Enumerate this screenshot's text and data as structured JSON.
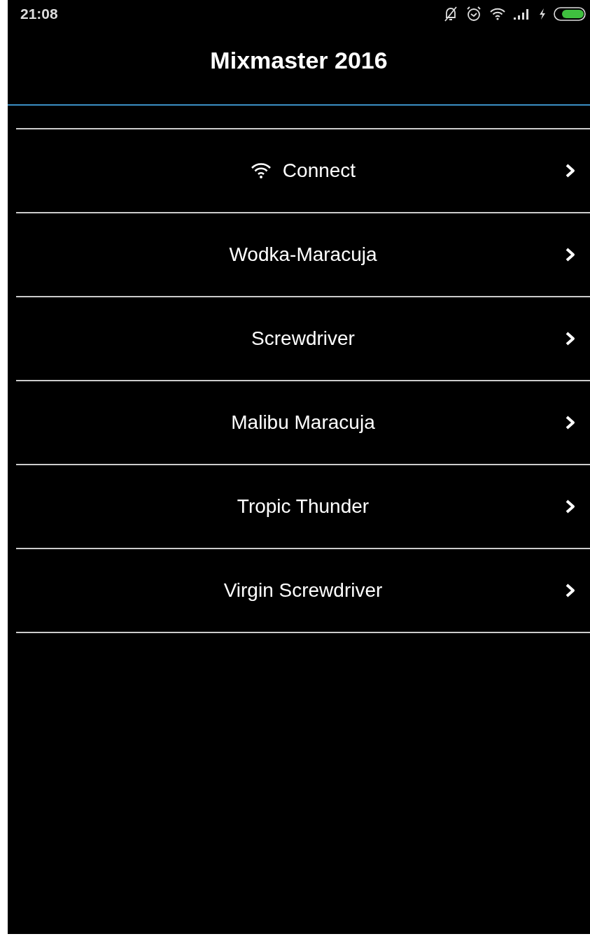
{
  "status_bar": {
    "time": "21:08"
  },
  "header": {
    "title": "Mixmaster 2016"
  },
  "items": [
    {
      "kind": "connect",
      "label": "Connect"
    },
    {
      "kind": "drink",
      "label": "Wodka-Maracuja"
    },
    {
      "kind": "drink",
      "label": "Screwdriver"
    },
    {
      "kind": "drink",
      "label": "Malibu Maracuja"
    },
    {
      "kind": "drink",
      "label": "Tropic Thunder"
    },
    {
      "kind": "drink",
      "label": "Virgin Screwdriver"
    }
  ]
}
